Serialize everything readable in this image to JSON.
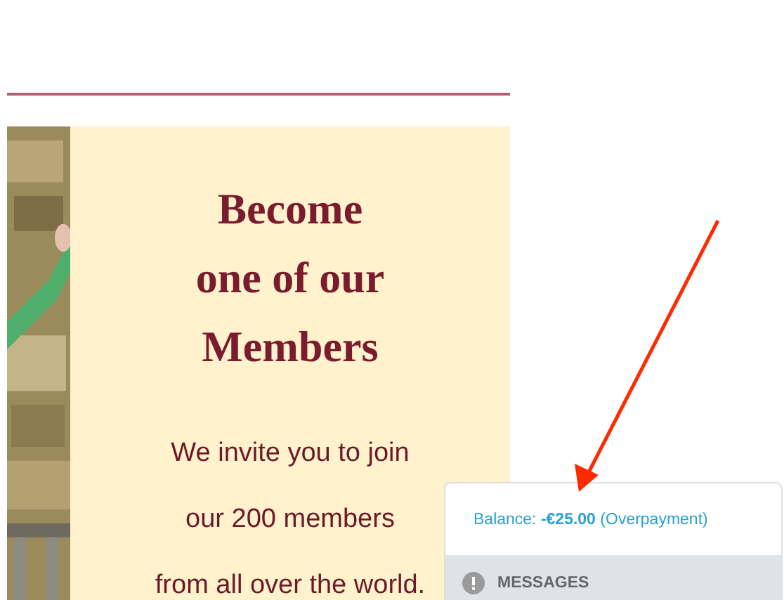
{
  "promo": {
    "heading_lines": [
      "Become",
      "one of our",
      "Members"
    ],
    "body_lines": [
      "We invite you to join",
      "our 200 members",
      "from all over the world."
    ]
  },
  "account_panel": {
    "balance": "Balance: **-€25.00** (Overpayment)",
    "messages_label": "MESSAGES"
  }
}
